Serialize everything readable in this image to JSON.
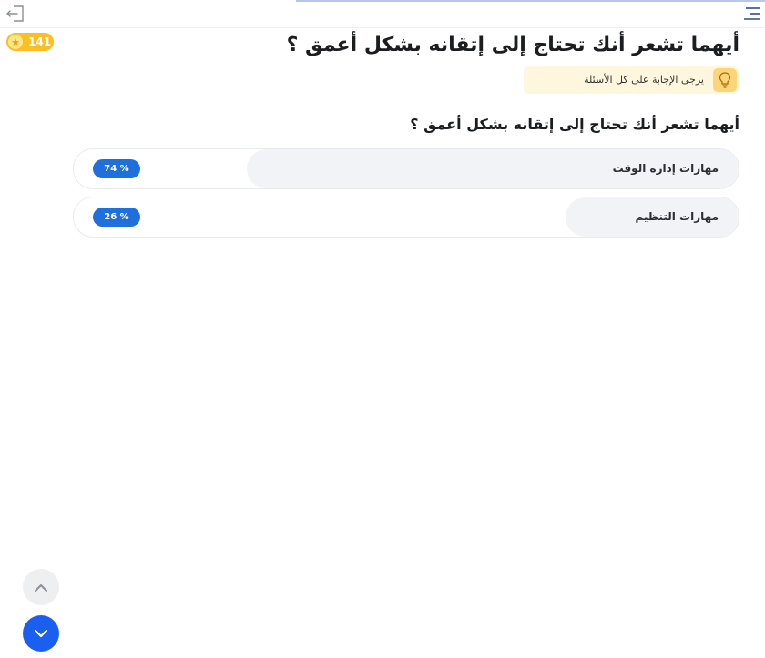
{
  "header": {
    "exit_icon": "exit-icon",
    "menu_icon": "hamburger-menu-icon",
    "accent_color": "#b9c6e6"
  },
  "coins": {
    "count": "141",
    "icon": "star-icon",
    "color": "#fbbf24"
  },
  "page": {
    "title": "أيهما تشعر أنك تحتاج إلى إتقانه بشكل أعمق ؟",
    "hint": "يرجى الإجابة على كل الأسئلة",
    "hint_icon": "lightbulb-icon",
    "question": "أيهما تشعر أنك تحتاج إلى إتقانه بشكل أعمق ؟"
  },
  "options": [
    {
      "label": "مهارات إدارة الوقت",
      "percent_text": "74 %",
      "percent": 74
    },
    {
      "label": "مهارات التنظيم",
      "percent_text": "26 %",
      "percent": 26
    }
  ],
  "scroll": {
    "up_icon": "chevron-up-icon",
    "down_icon": "chevron-down-icon",
    "down_color": "#1a5ff0"
  }
}
